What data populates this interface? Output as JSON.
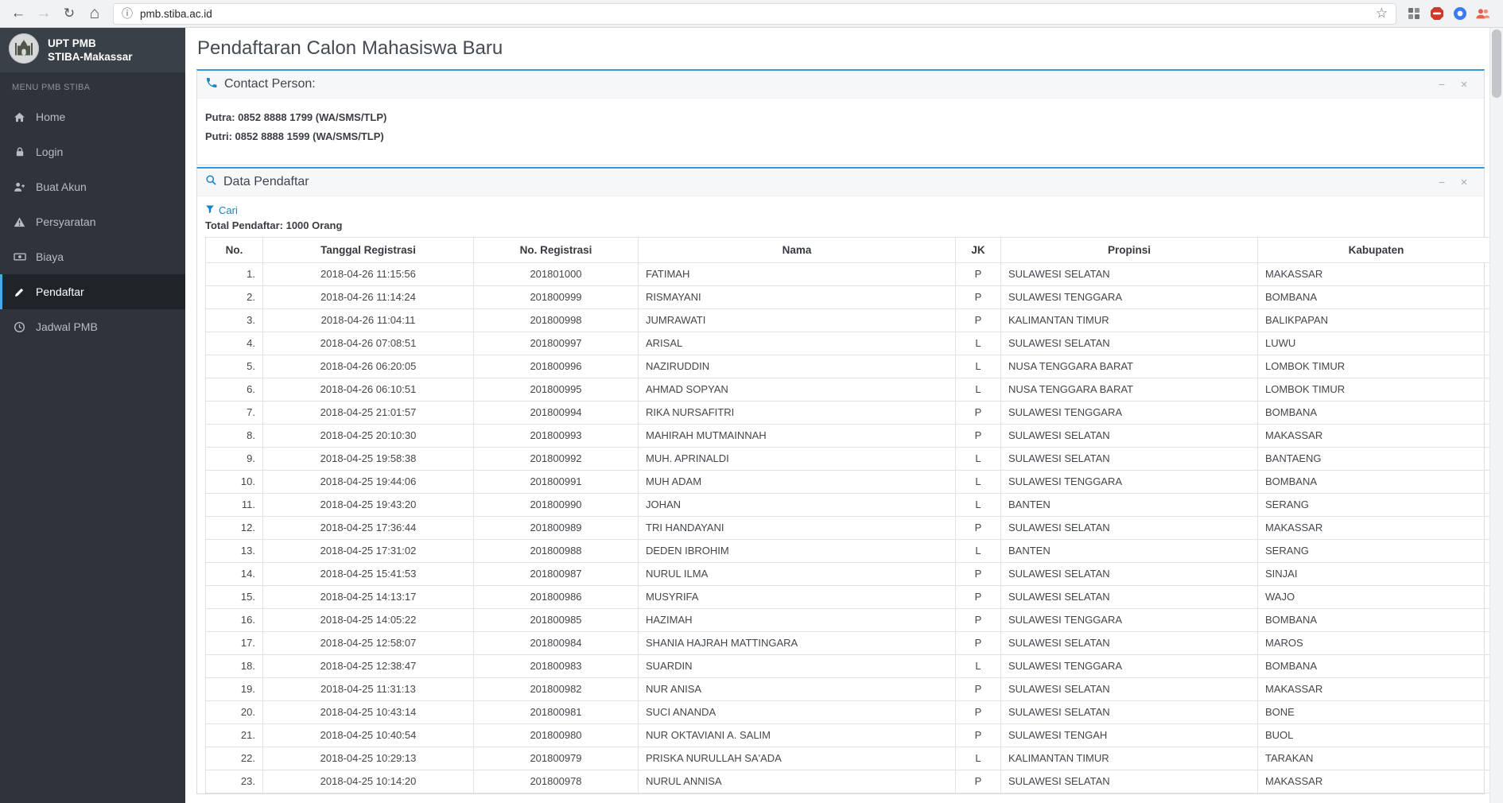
{
  "browser": {
    "url": "pmb.stiba.ac.id"
  },
  "colors": {
    "accent_blue": "#3698d9",
    "link_blue": "#1a82c3",
    "sidebar_bg": "#2e343a",
    "active_item_bg": "#1f2428"
  },
  "sidebar": {
    "brand_line1": "UPT PMB",
    "brand_line2": "STIBA-Makassar",
    "section_label": "MENU PMB STIBA",
    "items": [
      {
        "label": "Home",
        "icon": "home-icon",
        "active": false
      },
      {
        "label": "Login",
        "icon": "lock-icon",
        "active": false
      },
      {
        "label": "Buat Akun",
        "icon": "user-plus-icon",
        "active": false
      },
      {
        "label": "Persyaratan",
        "icon": "warning-icon",
        "active": false
      },
      {
        "label": "Biaya",
        "icon": "money-icon",
        "active": false
      },
      {
        "label": "Pendaftar",
        "icon": "edit-icon",
        "active": true
      },
      {
        "label": "Jadwal PMB",
        "icon": "clock-icon",
        "active": false
      }
    ]
  },
  "page": {
    "title": "Pendaftaran Calon Mahasiswa Baru"
  },
  "contact_panel": {
    "title": "Contact Person:",
    "lines": [
      "Putra: 0852 8888 1799 (WA/SMS/TLP)",
      "Putri: 0852 8888 1599 (WA/SMS/TLP)"
    ]
  },
  "data_panel": {
    "title": "Data Pendaftar",
    "search_link": "Cari",
    "total_label": "Total Pendaftar: 1000 Orang",
    "table": {
      "headers": [
        "No.",
        "Tanggal Registrasi",
        "No. Registrasi",
        "Nama",
        "JK",
        "Propinsi",
        "Kabupaten"
      ],
      "rows": [
        [
          "1.",
          "2018-04-26 11:15:56",
          "201801000",
          "FATIMAH",
          "P",
          "SULAWESI SELATAN",
          "MAKASSAR"
        ],
        [
          "2.",
          "2018-04-26 11:14:24",
          "201800999",
          "RISMAYANI",
          "P",
          "SULAWESI TENGGARA",
          "BOMBANA"
        ],
        [
          "3.",
          "2018-04-26 11:04:11",
          "201800998",
          "JUMRAWATI",
          "P",
          "KALIMANTAN TIMUR",
          "BALIKPAPAN"
        ],
        [
          "4.",
          "2018-04-26 07:08:51",
          "201800997",
          "ARISAL",
          "L",
          "SULAWESI SELATAN",
          "LUWU"
        ],
        [
          "5.",
          "2018-04-26 06:20:05",
          "201800996",
          "NAZIRUDDIN",
          "L",
          "NUSA TENGGARA BARAT",
          "LOMBOK TIMUR"
        ],
        [
          "6.",
          "2018-04-26 06:10:51",
          "201800995",
          "AHMAD SOPYAN",
          "L",
          "NUSA TENGGARA BARAT",
          "LOMBOK TIMUR"
        ],
        [
          "7.",
          "2018-04-25 21:01:57",
          "201800994",
          "RIKA NURSAFITRI",
          "P",
          "SULAWESI TENGGARA",
          "BOMBANA"
        ],
        [
          "8.",
          "2018-04-25 20:10:30",
          "201800993",
          "MAHIRAH MUTMAINNAH",
          "P",
          "SULAWESI SELATAN",
          "MAKASSAR"
        ],
        [
          "9.",
          "2018-04-25 19:58:38",
          "201800992",
          "MUH. APRINALDI",
          "L",
          "SULAWESI SELATAN",
          "BANTAENG"
        ],
        [
          "10.",
          "2018-04-25 19:44:06",
          "201800991",
          "MUH ADAM",
          "L",
          "SULAWESI TENGGARA",
          "BOMBANA"
        ],
        [
          "11.",
          "2018-04-25 19:43:20",
          "201800990",
          "JOHAN",
          "L",
          "BANTEN",
          "SERANG"
        ],
        [
          "12.",
          "2018-04-25 17:36:44",
          "201800989",
          "TRI HANDAYANI",
          "P",
          "SULAWESI SELATAN",
          "MAKASSAR"
        ],
        [
          "13.",
          "2018-04-25 17:31:02",
          "201800988",
          "DEDEN IBROHIM",
          "L",
          "BANTEN",
          "SERANG"
        ],
        [
          "14.",
          "2018-04-25 15:41:53",
          "201800987",
          "NURUL ILMA",
          "P",
          "SULAWESI SELATAN",
          "SINJAI"
        ],
        [
          "15.",
          "2018-04-25 14:13:17",
          "201800986",
          "MUSYRIFA",
          "P",
          "SULAWESI SELATAN",
          "WAJO"
        ],
        [
          "16.",
          "2018-04-25 14:05:22",
          "201800985",
          "HAZIMAH",
          "P",
          "SULAWESI TENGGARA",
          "BOMBANA"
        ],
        [
          "17.",
          "2018-04-25 12:58:07",
          "201800984",
          "SHANIA HAJRAH MATTINGARA",
          "P",
          "SULAWESI SELATAN",
          "MAROS"
        ],
        [
          "18.",
          "2018-04-25 12:38:47",
          "201800983",
          "SUARDIN",
          "L",
          "SULAWESI TENGGARA",
          "BOMBANA"
        ],
        [
          "19.",
          "2018-04-25 11:31:13",
          "201800982",
          "NUR ANISA",
          "P",
          "SULAWESI SELATAN",
          "MAKASSAR"
        ],
        [
          "20.",
          "2018-04-25 10:43:14",
          "201800981",
          "SUCI ANANDA",
          "P",
          "SULAWESI SELATAN",
          "BONE"
        ],
        [
          "21.",
          "2018-04-25 10:40:54",
          "201800980",
          "NUR OKTAVIANI A. SALIM",
          "P",
          "SULAWESI TENGAH",
          "BUOL"
        ],
        [
          "22.",
          "2018-04-25 10:29:13",
          "201800979",
          "PRISKA NURULLAH SA'ADA",
          "L",
          "KALIMANTAN TIMUR",
          "TARAKAN"
        ],
        [
          "23.",
          "2018-04-25 10:14:20",
          "201800978",
          "NURUL ANNISA",
          "P",
          "SULAWESI SELATAN",
          "MAKASSAR"
        ]
      ]
    }
  }
}
